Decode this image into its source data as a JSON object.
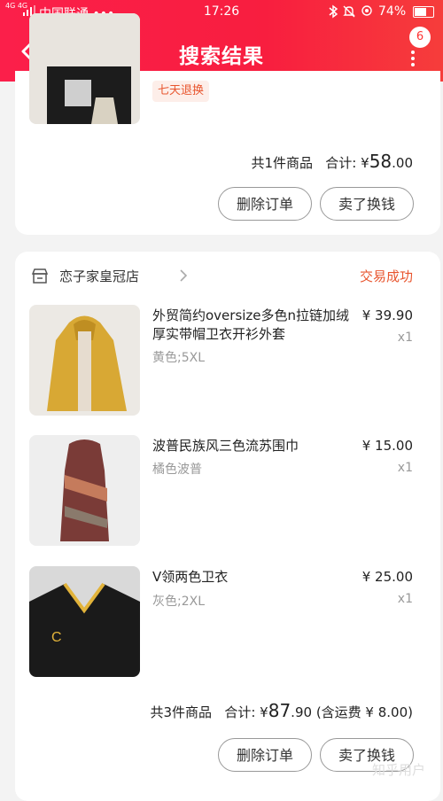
{
  "status_bar": {
    "network": "4G 4G",
    "carrier": "中国联通 •••",
    "time": "17:26",
    "battery": "74%",
    "battery_level": 0.74
  },
  "header": {
    "title": "搜索结果",
    "badge": "6"
  },
  "order1": {
    "return_tag": "七天退换",
    "summary_count": "共1件商品",
    "summary_label": "合计:",
    "currency": "¥",
    "total_int": "58",
    "total_dec": ".00",
    "delete_label": "删除订单",
    "sell_label": "卖了换钱"
  },
  "order2": {
    "shop_name": "恋子家皇冠店",
    "status": "交易成功",
    "items": [
      {
        "name": "外贸简约oversize多色n拉链加绒厚实带帽卫衣开衫外套",
        "spec": "黄色;5XL",
        "price": "¥ 39.90",
        "qty": "x1"
      },
      {
        "name": "波普民族风三色流苏围巾",
        "spec": "橘色波普",
        "price": "¥ 15.00",
        "qty": "x1"
      },
      {
        "name": "V领两色卫衣",
        "spec": "灰色;2XL",
        "price": "¥ 25.00",
        "qty": "x1"
      }
    ],
    "summary_count": "共3件商品",
    "summary_label": "合计:",
    "currency": "¥",
    "total_int": "87",
    "total_dec": ".90",
    "shipping": "(含运费 ¥ 8.00)",
    "delete_label": "删除订单",
    "sell_label": "卖了换钱"
  },
  "watermark": "知乎用户",
  "colors": {
    "header": "#f81e3f",
    "accent": "#e8552e"
  }
}
